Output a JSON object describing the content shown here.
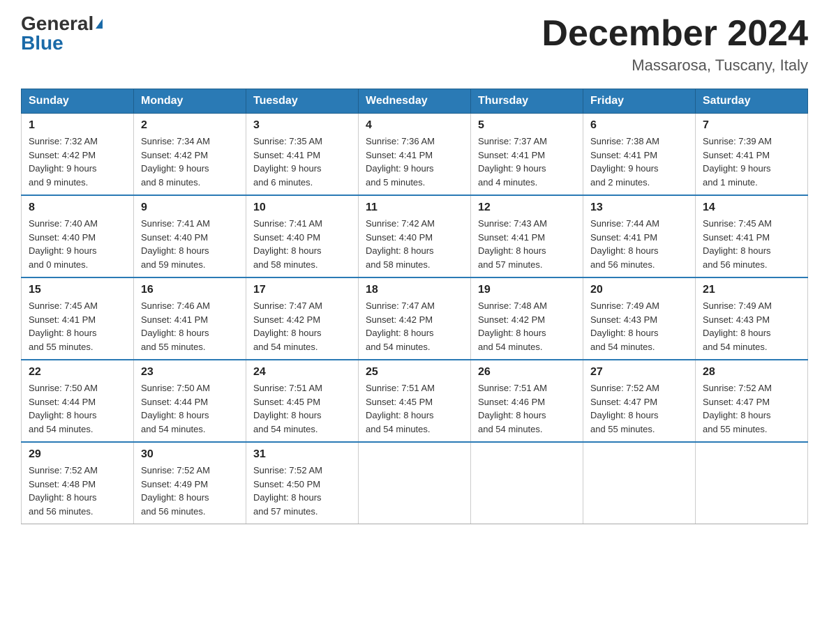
{
  "logo": {
    "general": "General",
    "blue": "Blue"
  },
  "title": "December 2024",
  "location": "Massarosa, Tuscany, Italy",
  "days_of_week": [
    "Sunday",
    "Monday",
    "Tuesday",
    "Wednesday",
    "Thursday",
    "Friday",
    "Saturday"
  ],
  "weeks": [
    [
      {
        "day": "1",
        "sunrise": "7:32 AM",
        "sunset": "4:42 PM",
        "daylight": "9 hours and 9 minutes."
      },
      {
        "day": "2",
        "sunrise": "7:34 AM",
        "sunset": "4:42 PM",
        "daylight": "9 hours and 8 minutes."
      },
      {
        "day": "3",
        "sunrise": "7:35 AM",
        "sunset": "4:41 PM",
        "daylight": "9 hours and 6 minutes."
      },
      {
        "day": "4",
        "sunrise": "7:36 AM",
        "sunset": "4:41 PM",
        "daylight": "9 hours and 5 minutes."
      },
      {
        "day": "5",
        "sunrise": "7:37 AM",
        "sunset": "4:41 PM",
        "daylight": "9 hours and 4 minutes."
      },
      {
        "day": "6",
        "sunrise": "7:38 AM",
        "sunset": "4:41 PM",
        "daylight": "9 hours and 2 minutes."
      },
      {
        "day": "7",
        "sunrise": "7:39 AM",
        "sunset": "4:41 PM",
        "daylight": "9 hours and 1 minute."
      }
    ],
    [
      {
        "day": "8",
        "sunrise": "7:40 AM",
        "sunset": "4:40 PM",
        "daylight": "9 hours and 0 minutes."
      },
      {
        "day": "9",
        "sunrise": "7:41 AM",
        "sunset": "4:40 PM",
        "daylight": "8 hours and 59 minutes."
      },
      {
        "day": "10",
        "sunrise": "7:41 AM",
        "sunset": "4:40 PM",
        "daylight": "8 hours and 58 minutes."
      },
      {
        "day": "11",
        "sunrise": "7:42 AM",
        "sunset": "4:40 PM",
        "daylight": "8 hours and 58 minutes."
      },
      {
        "day": "12",
        "sunrise": "7:43 AM",
        "sunset": "4:41 PM",
        "daylight": "8 hours and 57 minutes."
      },
      {
        "day": "13",
        "sunrise": "7:44 AM",
        "sunset": "4:41 PM",
        "daylight": "8 hours and 56 minutes."
      },
      {
        "day": "14",
        "sunrise": "7:45 AM",
        "sunset": "4:41 PM",
        "daylight": "8 hours and 56 minutes."
      }
    ],
    [
      {
        "day": "15",
        "sunrise": "7:45 AM",
        "sunset": "4:41 PM",
        "daylight": "8 hours and 55 minutes."
      },
      {
        "day": "16",
        "sunrise": "7:46 AM",
        "sunset": "4:41 PM",
        "daylight": "8 hours and 55 minutes."
      },
      {
        "day": "17",
        "sunrise": "7:47 AM",
        "sunset": "4:42 PM",
        "daylight": "8 hours and 54 minutes."
      },
      {
        "day": "18",
        "sunrise": "7:47 AM",
        "sunset": "4:42 PM",
        "daylight": "8 hours and 54 minutes."
      },
      {
        "day": "19",
        "sunrise": "7:48 AM",
        "sunset": "4:42 PM",
        "daylight": "8 hours and 54 minutes."
      },
      {
        "day": "20",
        "sunrise": "7:49 AM",
        "sunset": "4:43 PM",
        "daylight": "8 hours and 54 minutes."
      },
      {
        "day": "21",
        "sunrise": "7:49 AM",
        "sunset": "4:43 PM",
        "daylight": "8 hours and 54 minutes."
      }
    ],
    [
      {
        "day": "22",
        "sunrise": "7:50 AM",
        "sunset": "4:44 PM",
        "daylight": "8 hours and 54 minutes."
      },
      {
        "day": "23",
        "sunrise": "7:50 AM",
        "sunset": "4:44 PM",
        "daylight": "8 hours and 54 minutes."
      },
      {
        "day": "24",
        "sunrise": "7:51 AM",
        "sunset": "4:45 PM",
        "daylight": "8 hours and 54 minutes."
      },
      {
        "day": "25",
        "sunrise": "7:51 AM",
        "sunset": "4:45 PM",
        "daylight": "8 hours and 54 minutes."
      },
      {
        "day": "26",
        "sunrise": "7:51 AM",
        "sunset": "4:46 PM",
        "daylight": "8 hours and 54 minutes."
      },
      {
        "day": "27",
        "sunrise": "7:52 AM",
        "sunset": "4:47 PM",
        "daylight": "8 hours and 55 minutes."
      },
      {
        "day": "28",
        "sunrise": "7:52 AM",
        "sunset": "4:47 PM",
        "daylight": "8 hours and 55 minutes."
      }
    ],
    [
      {
        "day": "29",
        "sunrise": "7:52 AM",
        "sunset": "4:48 PM",
        "daylight": "8 hours and 56 minutes."
      },
      {
        "day": "30",
        "sunrise": "7:52 AM",
        "sunset": "4:49 PM",
        "daylight": "8 hours and 56 minutes."
      },
      {
        "day": "31",
        "sunrise": "7:52 AM",
        "sunset": "4:50 PM",
        "daylight": "8 hours and 57 minutes."
      },
      null,
      null,
      null,
      null
    ]
  ]
}
